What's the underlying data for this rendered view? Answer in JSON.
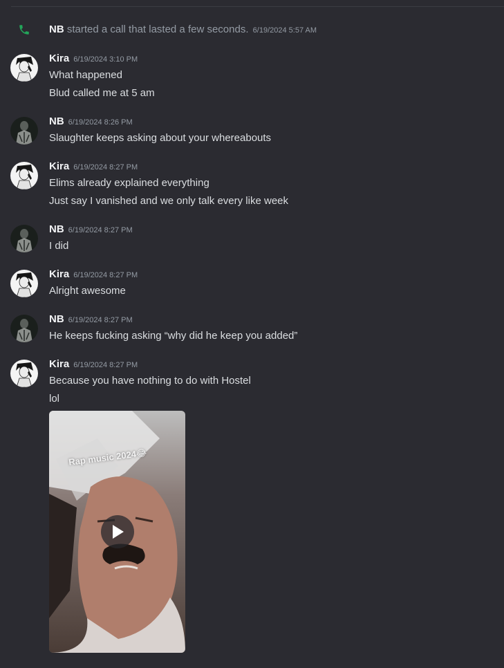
{
  "colors": {
    "background": "#2b2b31",
    "author": "#f2f3f5",
    "message": "#dbdee1",
    "muted": "#949ba4",
    "call_green": "#23a55a"
  },
  "system_call": {
    "icon": "phone-icon",
    "name": "NB",
    "text": "started a call that lasted a few seconds.",
    "time": "6/19/2024 5:57 AM"
  },
  "messages": [
    {
      "author": "Kira",
      "time": "6/19/2024 3:10 PM",
      "lines": [
        "What happened",
        "Blud called me at 5 am"
      ]
    },
    {
      "author": "NB",
      "time": "6/19/2024 8:26 PM",
      "lines": [
        "Slaughter keeps asking about your whereabouts"
      ]
    },
    {
      "author": "Kira",
      "time": "6/19/2024 8:27 PM",
      "lines": [
        "Elims already explained everything",
        "Just say I vanished and we only talk every like week"
      ]
    },
    {
      "author": "NB",
      "time": "6/19/2024 8:27 PM",
      "lines": [
        "I did"
      ]
    },
    {
      "author": "Kira",
      "time": "6/19/2024 8:27 PM",
      "lines": [
        "Alright awesome"
      ]
    },
    {
      "author": "NB",
      "time": "6/19/2024 8:27 PM",
      "lines": [
        "He keeps fucking asking “why did he keep you added”"
      ]
    },
    {
      "author": "Kira",
      "time": "6/19/2024 8:27 PM",
      "lines": [
        "Because you have nothing to do with Hostel",
        "lol"
      ]
    }
  ],
  "video_attachment": {
    "caption": "Rap music 2024😂",
    "play_icon": "play-icon"
  }
}
